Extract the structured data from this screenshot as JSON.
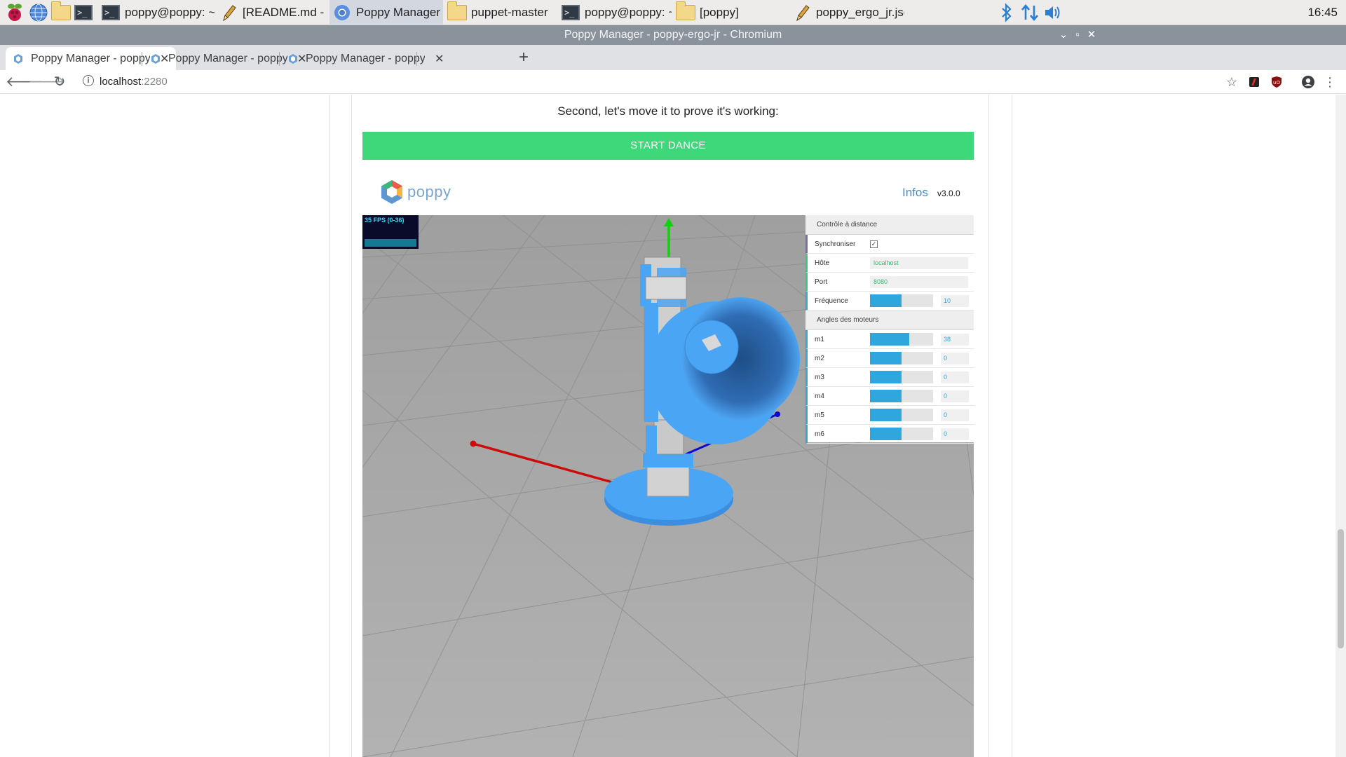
{
  "taskbar": {
    "tasks": [
      {
        "label": "poppy@poppy: ~/dev..."
      },
      {
        "label": "[README.md - Mous..."
      },
      {
        "label": "Poppy Manager - pop..."
      },
      {
        "label": "puppet-master"
      },
      {
        "label": "poppy@poppy: ~"
      },
      {
        "label": "[poppy]"
      },
      {
        "label": "poppy_ergo_jr.json - ..."
      }
    ],
    "clock": "16:45"
  },
  "window": {
    "title": "Poppy Manager - poppy-ergo-jr - Chromium"
  },
  "tabs": [
    {
      "label": "Poppy Manager - poppy-ergo-jr"
    },
    {
      "label": "Poppy Manager - poppy-ergo-jr"
    },
    {
      "label": "Poppy Manager - poppy-ergo-jr"
    }
  ],
  "address": {
    "host": "localhost",
    "port": ":2280"
  },
  "page": {
    "intro": "Second, let's move it to prove it's working:",
    "dance_button": "START DANCE",
    "logo_text": "poppy",
    "infos_link": "Infos",
    "version": "v3.0.0",
    "fps_label": "35 FPS (0-36)"
  },
  "panel": {
    "remote_section": "Contrôle à distance",
    "sync_label": "Synchroniser",
    "sync_checked": true,
    "host_label": "Hôte",
    "host_value": "localhost",
    "port_label": "Port",
    "port_value": "8080",
    "freq_label": "Fréquence",
    "freq_value": "10",
    "freq_fraction": 0.5,
    "motors_section": "Angles des moteurs",
    "motors": [
      {
        "name": "m1",
        "value": "38",
        "fraction": 0.62
      },
      {
        "name": "m2",
        "value": "0",
        "fraction": 0.5
      },
      {
        "name": "m3",
        "value": "0",
        "fraction": 0.5
      },
      {
        "name": "m4",
        "value": "0",
        "fraction": 0.5
      },
      {
        "name": "m5",
        "value": "0",
        "fraction": 0.5
      },
      {
        "name": "m6",
        "value": "0",
        "fraction": 0.5
      }
    ]
  },
  "colors": {
    "dance_button": "#3ed87a",
    "accent_blue": "#2fa6de",
    "robot_blue": "#4aa6f5",
    "scene_gray": "#a9a9a9"
  }
}
